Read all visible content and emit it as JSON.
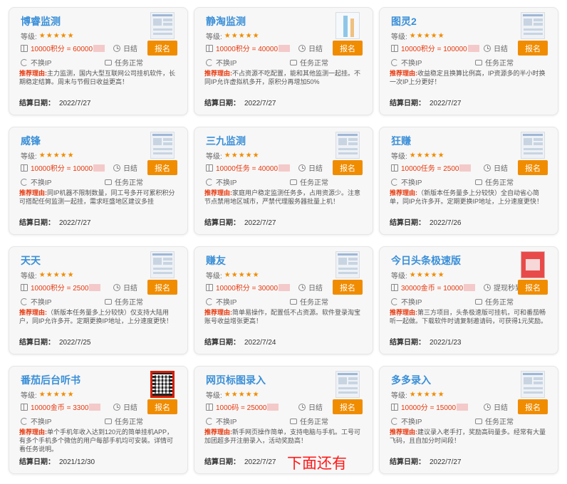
{
  "level_label": "等级:",
  "stars": "★★★★★",
  "no_ip_label": "不换IP",
  "status_label": "任务正常",
  "signup_label": "报名",
  "reason_label": "推荐理由:",
  "settle_date_label": "结算日期：",
  "footer_note": "下面还有",
  "colors": {
    "title": "#3a8fd8",
    "button": "#f08c00",
    "price": "#e8380d",
    "note": "#ff1a1a"
  },
  "cards": [
    {
      "title": "博睿监测",
      "price": "10000积分 = 60000",
      "settle": "日结",
      "reason": "主力监测，国内大型互联网公司挂机软件，长期稳定结算。周末与节假日收益更高！",
      "date": "2022/7/27"
    },
    {
      "title": "静淘监测",
      "price": "10000积分 = 40000",
      "settle": "日结",
      "reason": "不占资源不吃配置，能和其他监测一起挂。不同IP允许虚拟机多开，原积分再增加50%",
      "date": "2022/7/27"
    },
    {
      "title": "图灵2",
      "price": "10000积分 = 100000",
      "settle": "日结",
      "reason": "收益稳定且换算比例高，IP资源多的半小时换一次IP上分更好！",
      "date": "2022/7/27"
    },
    {
      "title": "威锋",
      "price": "10000积分 = 10000",
      "settle": "日结",
      "reason": "同IP机器不限制数量，同工号多开可累积积分可搭配任何监测一起挂，需求旺盛地区建议多挂",
      "date": "2022/7/27"
    },
    {
      "title": "三九监测",
      "price": "10000任务 = 40000",
      "settle": "日结",
      "reason": "家庭用户稳定监测任务多，占用资源少。注意节点禁用地区城市，严禁代理服务器批量上机！",
      "date": "2022/7/27"
    },
    {
      "title": "狂赚",
      "price": "10000任务 = 2500",
      "settle": "日结",
      "reason": "（新版本任务量多上分较快）全自动省心简单，同IP允许多开。定期更换IP地址，上分速度更快！",
      "date": "2022/7/26"
    },
    {
      "title": "天天",
      "price": "10000积分 = 2500",
      "settle": "日结",
      "reason": "（新版本任务量多上分较快）仅支持大陆用户，同IP允许多开。定期更换IP地址，上分速度更快！",
      "date": "2022/7/25"
    },
    {
      "title": "赚友",
      "price": "10000积分 = 30000",
      "settle": "日结",
      "reason": "简单易操作，配置低不占资源。软件登录淘宝账号收益增张更高！",
      "date": "2022/7/24"
    },
    {
      "title": "今日头条极速版",
      "price": "30000金币 = 10000",
      "settle": "提现秒到账",
      "reason": "第三方项目，头条极速版可挂机，可和番茄畅听一起做。下载软件时请复制邀请码，可获得1元奖励。",
      "date": "2022/1/23"
    },
    {
      "title": "番茄后台听书",
      "price": "10000金币 = 3300",
      "settle": "日结",
      "reason": "单个手机年收入达到120元的简单挂机APP，有多个手机多个微信的用户每部手机均可安装。详情可看任务说明。",
      "date": "2021/12/30"
    },
    {
      "title": "网页标图录入",
      "price": "1000码 = 25000",
      "settle": "日结",
      "reason": "新手网页操作简单，支持电脑与手机。工号可加团超多开注册录入，活动奖励高！",
      "date": "2022/7/27"
    },
    {
      "title": "多多录入",
      "price": "10000分 = 15000",
      "settle": "日结",
      "reason": "建议录入老手打，奖励高码量多。经常有大量飞码，且自加分时间段！",
      "date": "2022/7/27"
    }
  ]
}
